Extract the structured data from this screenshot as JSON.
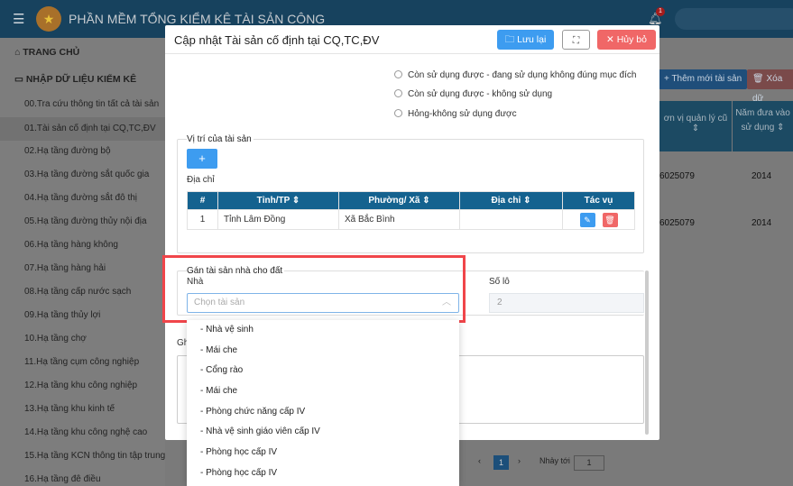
{
  "header": {
    "app_title": "PHẦN MỀM TỔNG KIỂM KÊ TÀI SẢN CÔNG",
    "notification_count": "1"
  },
  "sidebar": {
    "home": "TRANG CHỦ",
    "section": "NHẬP DỮ LIỆU KIỂM KÊ",
    "items": [
      "00.Tra cứu thông tin tất cả tài sản",
      "01.Tài sản cố định tại CQ,TC,ĐV",
      "02.Hạ tầng đường bộ",
      "03.Hạ tầng đường sắt quốc gia",
      "04.Hạ tầng đường sắt đô thị",
      "05.Hạ tầng đường thủy nội địa",
      "06.Hạ tầng hàng không",
      "07.Hạ tầng hàng hải",
      "08.Hạ tầng cấp nước sạch",
      "09.Hạ tầng thủy lợi",
      "10.Hạ tầng chợ",
      "11.Hạ tầng cụm công nghiệp",
      "12.Hạ tầng khu công nghiệp",
      "13.Hạ tầng khu kinh tế",
      "14.Hạ tầng khu công nghệ cao",
      "15.Hạ tầng KCN thông tin tập trung",
      "16.Hạ tầng đê điều"
    ]
  },
  "background": {
    "add_button": "+ Thêm mới tài sản",
    "delete_button": "Xóa dữ",
    "col_unit": "ơn vị quản lý cũ",
    "col_year": "Năm đưa vào sử dụng",
    "rows": [
      {
        "code": "6025079",
        "year": "2014"
      },
      {
        "code": "6025079",
        "year": "2014"
      }
    ],
    "pagination": {
      "page": "1",
      "jump_label": "Nhảy tới",
      "jump_value": "1"
    }
  },
  "modal": {
    "title": "Cập nhật Tài sản cố định tại CQ,TC,ĐV",
    "save": "Lưu lại",
    "cancel": "Hủy bỏ",
    "radios": [
      "Còn sử dụng được - đang sử dụng không đúng mục đích",
      "Còn sử dụng được - không sử dụng",
      "Hỏng-không sử dụng được"
    ],
    "location": {
      "legend": "Vị trí của tài sản",
      "add": "+",
      "address_label": "Địa chỉ",
      "headers": [
        "#",
        "Tỉnh/TP",
        "Phường/ Xã",
        "Địa chỉ",
        "Tác vụ"
      ],
      "rows": [
        {
          "no": "1",
          "province": "Tỉnh Lâm Đồng",
          "ward": "Xã Bắc Bình",
          "address": ""
        }
      ]
    },
    "assign": {
      "legend": "Gán tài sản nhà cho đất",
      "house_label": "Nhà",
      "house_placeholder": "Chọn tài sản",
      "lot_label": "Số lô",
      "lot_value": "2"
    },
    "note_label": "Gh",
    "dropdown_options": [
      "- Nhà vệ sinh",
      "- Mái che",
      "- Cổng rào",
      "- Mái che",
      "- Phòng chức năng cấp IV",
      "- Nhà vệ sinh giáo viên cấp IV",
      "- Phòng học cấp IV",
      "- Phòng học cấp IV"
    ]
  },
  "colors": {
    "primary": "#3d9cf0",
    "danger": "#f06767",
    "table_header": "#14628f",
    "highlight": "#f0454a"
  }
}
